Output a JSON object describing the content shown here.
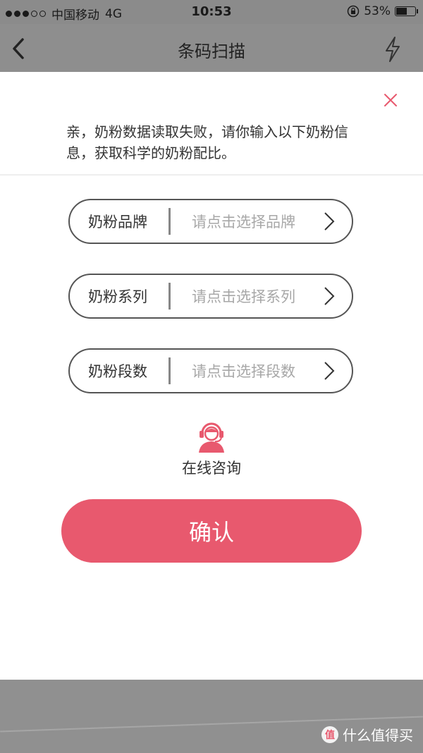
{
  "status_bar": {
    "carrier": "中国移动",
    "network": "4G",
    "time": "10:53",
    "battery_percent": "53%",
    "signal_filled_dots": 3,
    "signal_total_dots": 5
  },
  "nav": {
    "title": "条码扫描",
    "back_icon": "chevron-left-icon",
    "flash_icon": "flash-icon"
  },
  "panel": {
    "close_icon": "close-icon",
    "notice": "亲，奶粉数据读取失败，请你输入以下奶粉信息，获取科学的奶粉配比。"
  },
  "fields": [
    {
      "label": "奶粉品牌",
      "placeholder": "请点击选择品牌"
    },
    {
      "label": "奶粉系列",
      "placeholder": "请点击选择系列"
    },
    {
      "label": "奶粉段数",
      "placeholder": "请点击选择段数"
    }
  ],
  "consult": {
    "label": "在线咨询",
    "icon": "customer-service-icon"
  },
  "confirm_label": "确认",
  "watermark": {
    "text": "什么值得买",
    "icon_text": "值"
  },
  "colors": {
    "accent": "#e8596e",
    "overlay": "#8e8e8e"
  }
}
